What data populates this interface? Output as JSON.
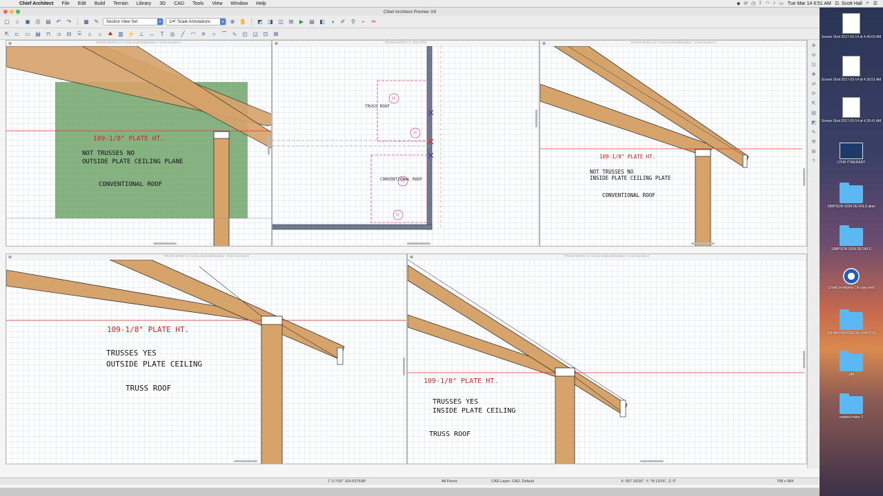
{
  "menubar": {
    "app_name": "Chief Architect",
    "menus": [
      "File",
      "Edit",
      "Build",
      "Terrain",
      "Library",
      "3D",
      "CAD",
      "Tools",
      "View",
      "Window",
      "Help"
    ],
    "clock": "Tue Mar 14  6:51 AM",
    "user": "D. Scott Hall"
  },
  "window": {
    "title": "Chief Architect Premier X9"
  },
  "toolbar": {
    "view_set": "Section View Set",
    "scale_set": "1/4\" Scale Annotations"
  },
  "views": {
    "v1": {
      "header": "TRUSS WARS V.2: Cross Section/Elevation - Cross Section 1",
      "plate_ht": "109-1/8\" PLATE HT.",
      "line1": "NOT TRUSSES NO",
      "line2": "OUTSIDE PLATE CEILING PLANE",
      "roof": "CONVENTIONAL ROOF"
    },
    "v2": {
      "header": "TRUSS WARS V.2: Floor Plan",
      "truss_roof": "TRUSS ROOF",
      "conv_roof": "CONVENTIONAL ROOF",
      "tags": [
        "S4",
        "S3",
        "S2",
        "S1"
      ]
    },
    "v3": {
      "header": "TRUSS WARS V.2: Cross Section/Elevation - Cross Section 2",
      "plate_ht": "109-1/8\" PLATE HT.",
      "line1": "NOT TRUSSES  NO",
      "line2": "INSIDE PLATE CEILING PLATE",
      "roof": "CONVENTIONAL ROOF"
    },
    "v4": {
      "header": "TRUSS WARS V.2: Cross Section/Elevation - Cross Section 3",
      "plate_ht": "109-1/8\" PLATE HT.",
      "line1": "TRUSSES YES",
      "line2": "OUTSIDE PLATE CEILING",
      "roof": "TRUSS ROOF"
    },
    "v5": {
      "header": "TRUSS WARS V.2: Cross Section/Elevation - Cross Section 4",
      "plate_ht": "109-1/8\" PLATE HT.",
      "line1": "TRUSSES YES",
      "line2": "INSIDE PLATE CEILING",
      "roof": "TRUSS ROOF"
    }
  },
  "statusbar": {
    "length": "7'-3 7/16\"  324.637538°",
    "floor": "All Floors",
    "layer": "CAD Layer: CAD,  Default",
    "coords": "X: 557 15/16\", Y: 78 13/16\", Z: 0\"",
    "size": "758 x 584"
  },
  "desktop": {
    "items": [
      "Screen Shot 2017-03-14 at 4.40.03 AM",
      "Screen Shot 2017-03-14 at 4.39.51 AM",
      "Screen Shot 2017-03-14 at 4.39.41 AM",
      "LYNN ITINERARY",
      "SIMPSON SSW DETAILS alias",
      "SIMPSON SSW DETAILS",
      "ChiefCoreAlpine CA copy sent",
      "JOHAN HISTORICAL PHOTOS",
      "JIM",
      "untitled folder 2"
    ]
  },
  "colors": {
    "lumber": "#d6a36a",
    "plate_line": "#e0302e",
    "overlay": "#5f9a5a",
    "plan_tag": "#e0409a"
  }
}
